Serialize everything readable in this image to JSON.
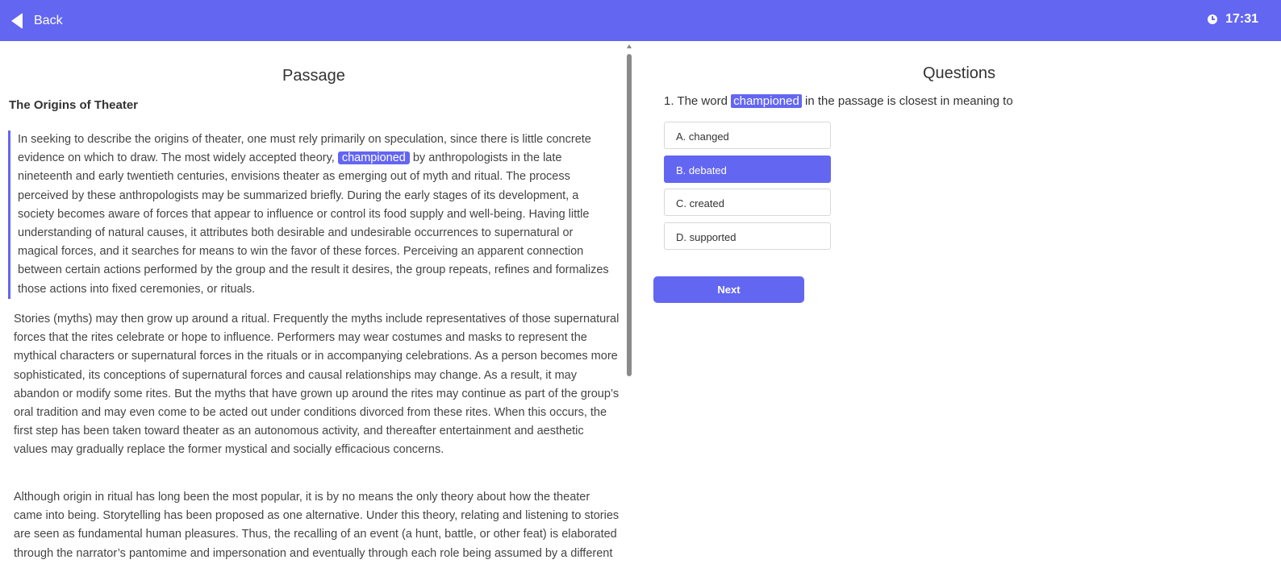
{
  "header": {
    "back_label": "Back",
    "timer": "17:31",
    "back_icon": "back-arrow-icon",
    "clock_icon": "clock-icon",
    "accent_color": "#6366f1"
  },
  "passage": {
    "pane_title": "Passage",
    "heading": "The Origins of Theater",
    "paragraphs": [
      {
        "before": "In seeking to describe the origins of theater, one must rely primarily on speculation, since there is little concrete evidence on which to draw. The most widely accepted theory, ",
        "highlight": "championed",
        "after": " by anthropologists in the late nineteenth and early twentieth centuries, envisions theater as emerging out of myth and ritual. The process perceived by these anthropologists may be summarized briefly. During the early stages of its development, a society becomes aware of forces that appear to influence or control its food supply and well-being. Having little understanding of natural causes, it attributes both desirable and undesirable occurrences to supernatural or magical forces, and it searches for means to win the favor of these forces. Perceiving an apparent connection between certain actions performed by the group and the result it desires, the group repeats, refines and formalizes those actions into fixed ceremonies, or rituals."
      },
      {
        "text": "Stories (myths) may then grow up around a ritual. Frequently the myths include representatives of those supernatural forces that the rites celebrate or hope to influence. Performers may wear costumes and masks to represent the mythical characters or supernatural forces in the rituals or in accompanying celebrations. As a person becomes more sophisticated, its conceptions of supernatural forces and causal relationships may change. As a result, it may abandon or modify some rites. But the myths that have grown up around the rites may continue as part of the group’s oral tradition and may even come to be acted out under conditions divorced from these rites. When this occurs, the first step has been taken toward theater as an autonomous activity, and thereafter entertainment and aesthetic values may gradually replace the former mystical and socially efficacious concerns."
      },
      {
        "text": "Although origin in ritual has long been the most popular, it is by no means the only theory about how the theater came into being. Storytelling has been proposed as one alternative. Under this theory, relating and listening to stories are seen as fundamental human pleasures. Thus, the recalling of an event (a hunt, battle, or other feat) is elaborated through the narrator’s pantomime and impersonation and eventually through each role being assumed by a different person."
      }
    ]
  },
  "questions": {
    "pane_title": "Questions",
    "question": {
      "prefix": "1. The word ",
      "highlight": "championed",
      "suffix": " in the passage is closest in meaning to"
    },
    "options": [
      {
        "label": "A. changed",
        "selected": false
      },
      {
        "label": "B. debated",
        "selected": true
      },
      {
        "label": "C. created",
        "selected": false
      },
      {
        "label": "D. supported",
        "selected": false
      }
    ],
    "next_label": "Next"
  }
}
